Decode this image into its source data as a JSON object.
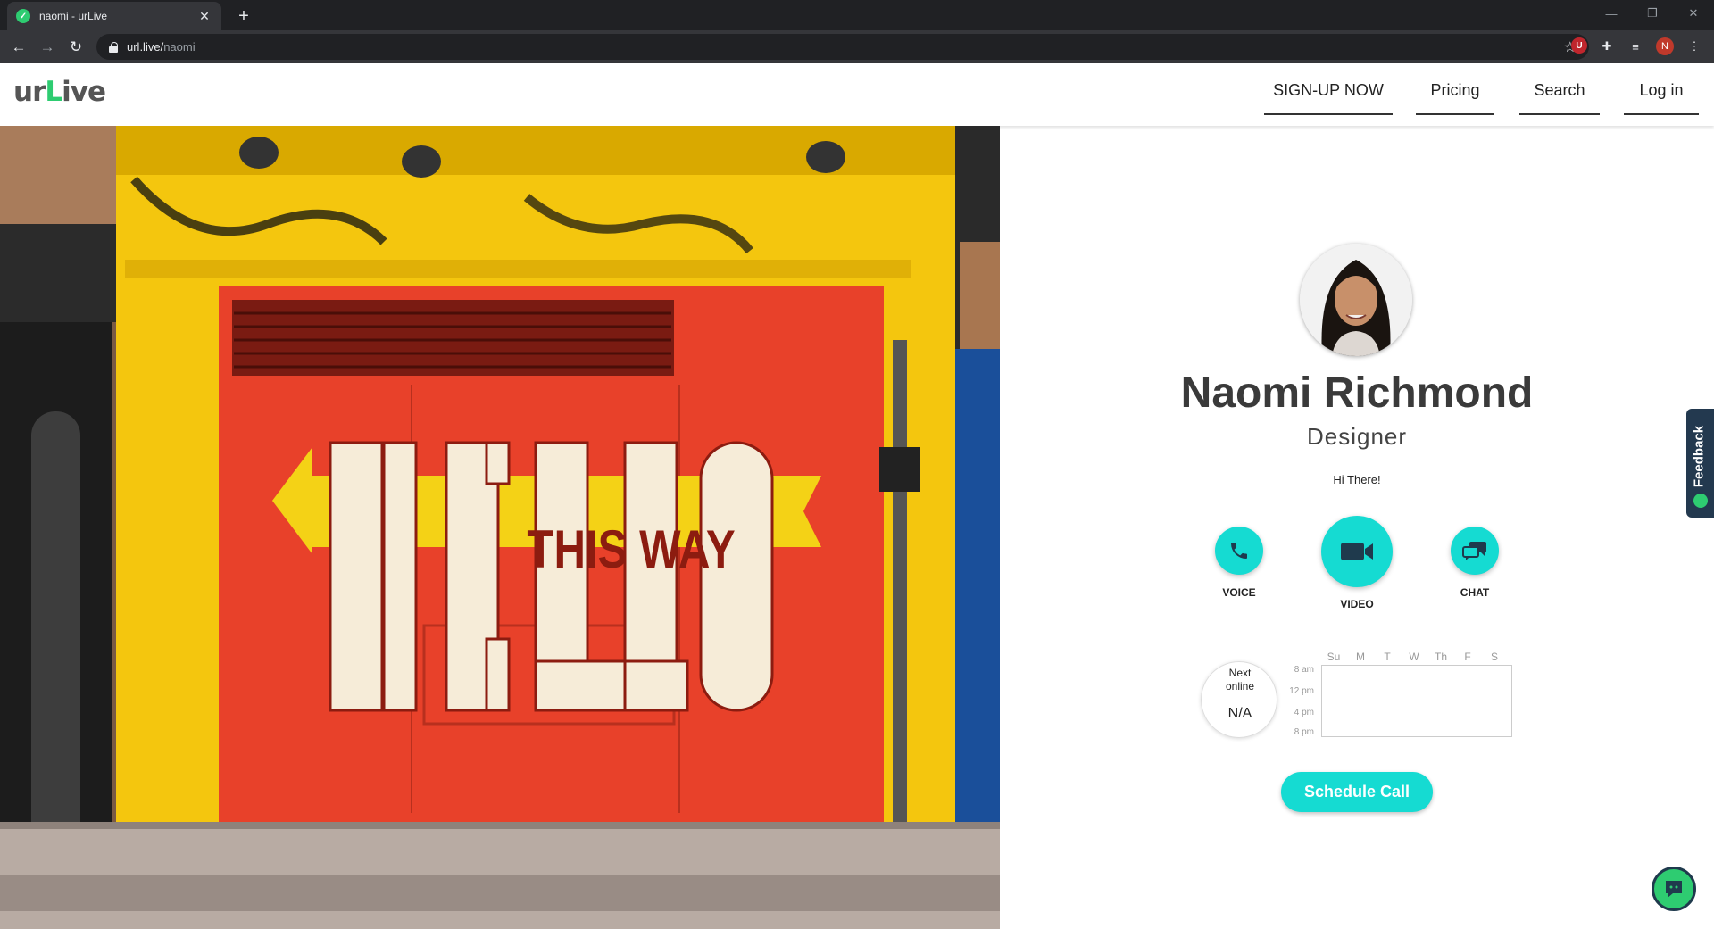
{
  "browser": {
    "tab_title": "naomi - urLive",
    "new_tab": "+",
    "url_host": "url.live/",
    "url_path": "naomi",
    "profile_initial": "N",
    "ext_u": "U"
  },
  "header": {
    "logo_left": "ur",
    "logo_accent": "L",
    "logo_right": "ive",
    "nav": [
      {
        "label": "SIGN-UP NOW"
      },
      {
        "label": "Pricing"
      },
      {
        "label": "Search"
      },
      {
        "label": "Log in"
      }
    ]
  },
  "hero": {
    "image_text_big": "HELLO",
    "image_text_small": "THIS WAY"
  },
  "profile": {
    "name": "Naomi Richmond",
    "role": "Designer",
    "greeting": "Hi There!"
  },
  "call_options": [
    {
      "label": "VOICE",
      "icon": "phone-icon"
    },
    {
      "label": "VIDEO",
      "icon": "video-camera-icon"
    },
    {
      "label": "CHAT",
      "icon": "chat-bubbles-icon"
    }
  ],
  "availability": {
    "next_online_label": "Next online",
    "next_online_value": "N/A",
    "days": [
      "Su",
      "M",
      "T",
      "W",
      "Th",
      "F",
      "S"
    ],
    "times": [
      "8 am",
      "12 pm",
      "4 pm",
      "8 pm"
    ]
  },
  "schedule_button": "Schedule Call",
  "feedback_tab": "Feedback",
  "colors": {
    "accent": "#15dbd2",
    "brand_green": "#2ecc71",
    "feedback_bg": "#23394f"
  }
}
